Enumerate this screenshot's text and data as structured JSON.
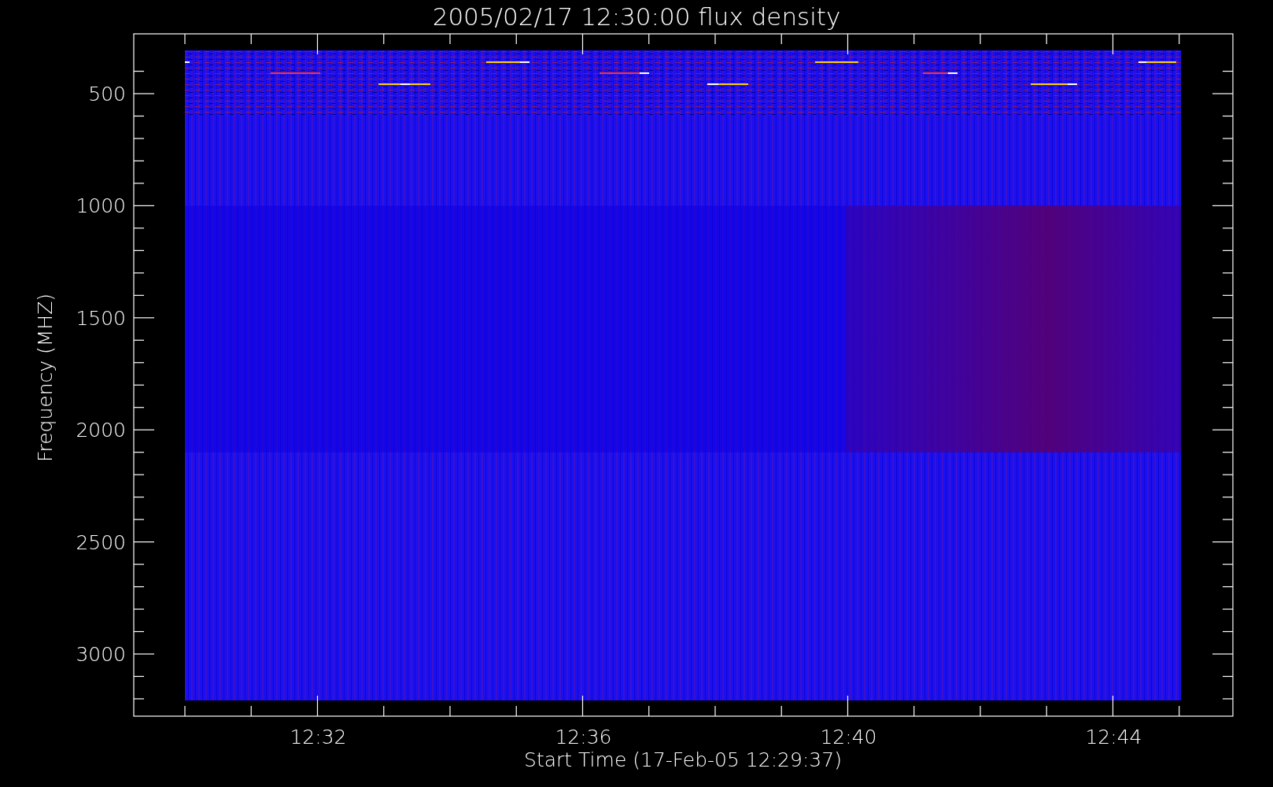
{
  "title": "2005/02/17 12:30:00 flux density",
  "y_axis": {
    "label": "Frequency (MHZ)",
    "ticks": [
      "500",
      "1000",
      "1500",
      "2000",
      "2500",
      "3000"
    ]
  },
  "x_axis": {
    "label": "Start Time (17-Feb-05 12:29:37)",
    "ticks": [
      "12:32",
      "12:36",
      "12:40",
      "12:44"
    ]
  }
}
